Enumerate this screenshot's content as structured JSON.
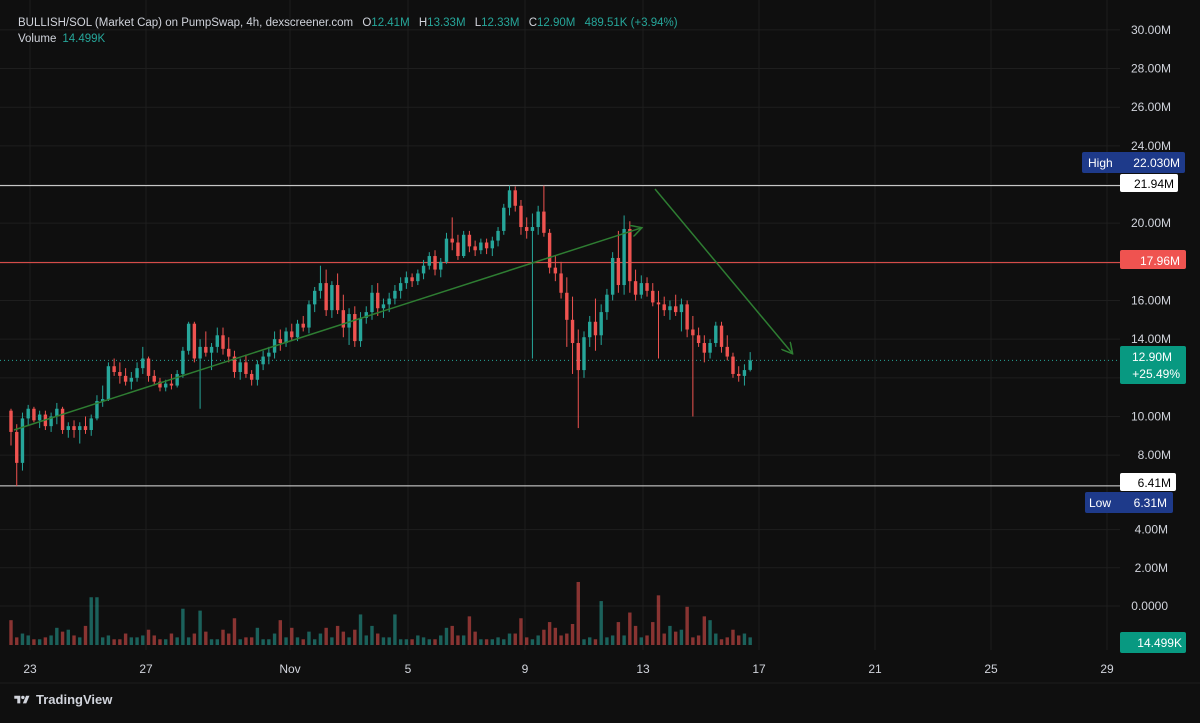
{
  "legend": {
    "symbol": "BULLISH/SOL (Market Cap) on PumpSwap, 4h, dexscreener.com",
    "open_label": "O",
    "open": "12.41M",
    "high_label": "H",
    "high": "13.33M",
    "low_label": "L",
    "low": "12.33M",
    "close_label": "C",
    "close": "12.90M",
    "change": "489.51K (+3.94%)",
    "volume_label": "Volume",
    "volume": "14.499K"
  },
  "brand": "TradingView",
  "colors": {
    "up": "#26a69a",
    "down": "#ef5350",
    "bg": "#0f0f0f",
    "grid": "#1e1e1e",
    "arrow": "#2e7d32",
    "highlow_badge": "#1e3a8a"
  },
  "price_axis": {
    "ticks": [
      "30.00M",
      "28.00M",
      "26.00M",
      "24.00M",
      "22.00M",
      "20.00M",
      "18.00M",
      "16.00M",
      "14.00M",
      "12.00M",
      "10.00M",
      "8.00M"
    ]
  },
  "volume_axis": {
    "ticks": [
      "4.00M",
      "2.00M",
      "0.0000"
    ]
  },
  "time_axis": {
    "ticks": [
      "23",
      "27",
      "Nov",
      "5",
      "9",
      "13",
      "17",
      "21",
      "25",
      "29"
    ]
  },
  "badges": {
    "high_label": "High",
    "high_value": "22.030M",
    "white_top": "21.94M",
    "red_line": "17.96M",
    "last_price": "12.90M",
    "last_change": "+25.49%",
    "white_bottom": "6.41M",
    "low_label": "Low",
    "low_value": "6.31M",
    "volume_last": "14.499K"
  },
  "chart_data": {
    "type": "candlestick",
    "interval": "4h",
    "y_axis_unit": "M",
    "ylim": [
      6.0,
      30.5
    ],
    "horizontal_lines": [
      21.94,
      17.96,
      6.41
    ],
    "candles": [
      [
        10.3,
        10.4,
        8.5,
        9.2
      ],
      [
        9.2,
        9.6,
        6.4,
        7.6
      ],
      [
        7.6,
        10.2,
        7.2,
        9.9
      ],
      [
        9.9,
        10.6,
        9.5,
        10.4
      ],
      [
        10.4,
        10.5,
        9.7,
        9.8
      ],
      [
        9.8,
        10.3,
        9.4,
        10.1
      ],
      [
        10.1,
        10.3,
        9.3,
        9.5
      ],
      [
        9.5,
        10.2,
        9.2,
        10.0
      ],
      [
        10.0,
        10.7,
        9.6,
        10.4
      ],
      [
        10.4,
        10.5,
        9.1,
        9.3
      ],
      [
        9.3,
        9.7,
        8.9,
        9.5
      ],
      [
        9.5,
        9.8,
        8.9,
        9.3
      ],
      [
        9.3,
        9.7,
        8.6,
        9.5
      ],
      [
        9.5,
        10.0,
        9.1,
        9.3
      ],
      [
        9.3,
        10.1,
        9.0,
        9.9
      ],
      [
        9.9,
        11.1,
        9.8,
        10.8
      ],
      [
        10.8,
        11.6,
        10.5,
        10.9
      ],
      [
        10.9,
        12.8,
        10.8,
        12.6
      ],
      [
        12.6,
        13.0,
        12.1,
        12.3
      ],
      [
        12.3,
        12.8,
        11.7,
        12.1
      ],
      [
        12.1,
        12.5,
        11.6,
        11.8
      ],
      [
        11.8,
        12.3,
        11.4,
        12.0
      ],
      [
        12.0,
        12.8,
        11.8,
        12.5
      ],
      [
        12.5,
        13.6,
        12.2,
        13.0
      ],
      [
        13.0,
        13.1,
        11.8,
        12.1
      ],
      [
        12.1,
        12.4,
        11.6,
        11.8
      ],
      [
        11.8,
        12.0,
        11.3,
        11.5
      ],
      [
        11.5,
        11.9,
        11.3,
        11.7
      ],
      [
        11.7,
        12.2,
        11.4,
        11.6
      ],
      [
        11.6,
        12.4,
        11.5,
        12.2
      ],
      [
        12.2,
        13.6,
        12.0,
        13.4
      ],
      [
        13.4,
        14.9,
        13.2,
        14.8
      ],
      [
        14.8,
        14.9,
        12.8,
        13.0
      ],
      [
        13.0,
        14.0,
        10.4,
        13.6
      ],
      [
        13.6,
        14.4,
        13.1,
        13.3
      ],
      [
        13.3,
        13.8,
        12.4,
        13.6
      ],
      [
        13.6,
        14.6,
        13.3,
        14.2
      ],
      [
        14.2,
        14.6,
        13.2,
        13.5
      ],
      [
        13.5,
        14.1,
        12.8,
        13.1
      ],
      [
        13.1,
        13.4,
        12.0,
        12.3
      ],
      [
        12.3,
        13.0,
        11.9,
        12.8
      ],
      [
        12.8,
        13.2,
        12.0,
        12.2
      ],
      [
        12.2,
        12.4,
        11.6,
        11.9
      ],
      [
        11.9,
        12.9,
        11.6,
        12.7
      ],
      [
        12.7,
        13.4,
        12.4,
        13.1
      ],
      [
        13.1,
        13.6,
        12.7,
        13.3
      ],
      [
        13.3,
        14.4,
        13.0,
        14.0
      ],
      [
        14.0,
        14.5,
        13.4,
        13.8
      ],
      [
        13.8,
        14.6,
        13.6,
        14.4
      ],
      [
        14.4,
        14.8,
        13.9,
        14.1
      ],
      [
        14.1,
        15.0,
        13.9,
        14.8
      ],
      [
        14.8,
        15.2,
        14.4,
        14.6
      ],
      [
        14.6,
        16.0,
        14.3,
        15.8
      ],
      [
        15.8,
        16.7,
        15.4,
        16.5
      ],
      [
        16.5,
        17.8,
        16.1,
        16.9
      ],
      [
        16.9,
        17.6,
        15.2,
        15.5
      ],
      [
        15.5,
        17.0,
        15.1,
        16.8
      ],
      [
        16.8,
        17.4,
        15.3,
        15.5
      ],
      [
        15.5,
        16.3,
        14.1,
        14.6
      ],
      [
        14.6,
        15.6,
        13.7,
        15.3
      ],
      [
        15.3,
        15.7,
        13.6,
        13.9
      ],
      [
        13.9,
        15.4,
        13.6,
        15.1
      ],
      [
        15.1,
        15.7,
        14.8,
        15.4
      ],
      [
        15.4,
        16.8,
        15.0,
        16.4
      ],
      [
        16.4,
        16.9,
        15.2,
        15.6
      ],
      [
        15.6,
        16.1,
        15.1,
        15.8
      ],
      [
        15.8,
        16.4,
        15.4,
        16.1
      ],
      [
        16.1,
        16.8,
        15.8,
        16.5
      ],
      [
        16.5,
        17.2,
        16.1,
        16.9
      ],
      [
        16.9,
        17.5,
        16.6,
        17.2
      ],
      [
        17.2,
        17.4,
        16.7,
        17.0
      ],
      [
        17.0,
        17.6,
        16.8,
        17.4
      ],
      [
        17.4,
        18.1,
        17.1,
        17.8
      ],
      [
        17.8,
        18.5,
        17.6,
        18.3
      ],
      [
        18.3,
        18.6,
        17.3,
        17.6
      ],
      [
        17.6,
        18.2,
        17.2,
        18.0
      ],
      [
        18.0,
        19.5,
        17.9,
        19.2
      ],
      [
        19.2,
        20.3,
        18.6,
        19.0
      ],
      [
        19.0,
        19.4,
        18.1,
        18.3
      ],
      [
        18.3,
        19.6,
        18.2,
        19.4
      ],
      [
        19.4,
        19.6,
        18.5,
        18.8
      ],
      [
        18.8,
        19.1,
        18.3,
        18.6
      ],
      [
        18.6,
        19.2,
        18.4,
        19.0
      ],
      [
        19.0,
        19.2,
        18.4,
        18.7
      ],
      [
        18.7,
        19.3,
        18.3,
        19.1
      ],
      [
        19.1,
        19.8,
        18.8,
        19.6
      ],
      [
        19.6,
        21.0,
        19.4,
        20.8
      ],
      [
        20.8,
        21.94,
        20.4,
        21.7
      ],
      [
        21.7,
        21.9,
        20.6,
        20.9
      ],
      [
        20.9,
        21.2,
        19.4,
        19.8
      ],
      [
        19.8,
        20.3,
        19.2,
        19.6
      ],
      [
        19.6,
        20.5,
        13.0,
        19.8
      ],
      [
        19.8,
        20.9,
        19.4,
        20.6
      ],
      [
        20.6,
        21.94,
        19.3,
        19.5
      ],
      [
        19.5,
        19.7,
        17.4,
        17.7
      ],
      [
        17.7,
        18.3,
        17.0,
        17.4
      ],
      [
        17.4,
        18.0,
        16.1,
        16.4
      ],
      [
        16.4,
        17.2,
        13.6,
        15.0
      ],
      [
        15.0,
        16.2,
        12.2,
        13.8
      ],
      [
        13.8,
        14.5,
        9.4,
        12.4
      ],
      [
        12.4,
        14.4,
        12.0,
        14.1
      ],
      [
        14.1,
        15.2,
        13.6,
        14.9
      ],
      [
        14.9,
        16.1,
        13.4,
        14.2
      ],
      [
        14.2,
        15.8,
        13.7,
        15.4
      ],
      [
        15.4,
        16.6,
        15.0,
        16.3
      ],
      [
        16.3,
        18.5,
        16.0,
        18.2
      ],
      [
        18.2,
        19.6,
        16.4,
        16.8
      ],
      [
        16.8,
        20.4,
        16.3,
        19.7
      ],
      [
        19.7,
        20.1,
        16.4,
        17.0
      ],
      [
        17.0,
        17.6,
        16.0,
        16.3
      ],
      [
        16.3,
        17.3,
        16.1,
        16.9
      ],
      [
        16.9,
        17.2,
        16.2,
        16.5
      ],
      [
        16.5,
        16.9,
        15.7,
        15.9
      ],
      [
        15.9,
        16.5,
        13.0,
        15.8
      ],
      [
        15.8,
        16.2,
        15.2,
        15.5
      ],
      [
        15.5,
        16.0,
        15.0,
        15.7
      ],
      [
        15.7,
        16.3,
        15.2,
        15.4
      ],
      [
        15.4,
        16.1,
        14.4,
        15.8
      ],
      [
        15.8,
        16.0,
        14.1,
        14.5
      ],
      [
        14.5,
        15.2,
        10.0,
        14.2
      ],
      [
        14.2,
        14.6,
        13.6,
        13.8
      ],
      [
        13.8,
        14.2,
        12.8,
        13.3
      ],
      [
        13.3,
        14.0,
        13.0,
        13.8
      ],
      [
        13.8,
        14.9,
        13.6,
        14.7
      ],
      [
        14.7,
        14.9,
        13.3,
        13.6
      ],
      [
        13.6,
        14.2,
        12.9,
        13.1
      ],
      [
        13.1,
        13.3,
        12.0,
        12.2
      ],
      [
        12.2,
        12.6,
        11.8,
        12.1
      ],
      [
        12.1,
        12.7,
        11.6,
        12.4
      ],
      [
        12.41,
        13.33,
        12.33,
        12.9
      ]
    ],
    "volume": [
      1.3,
      0.4,
      0.6,
      0.5,
      0.3,
      0.3,
      0.4,
      0.5,
      0.9,
      0.7,
      0.8,
      0.5,
      0.4,
      1.0,
      2.5,
      0.9,
      0.4,
      0.5,
      0.3,
      0.3,
      0.6,
      0.4,
      0.4,
      0.5,
      0.8,
      0.5,
      0.3,
      0.3,
      0.6,
      0.4,
      1.0,
      0.4,
      0.6,
      1.8,
      0.7,
      0.3,
      0.3,
      0.8,
      0.6,
      1.4,
      0.3,
      0.4,
      0.4,
      0.9,
      0.3,
      0.3,
      0.6,
      1.3,
      0.4,
      0.9,
      0.4,
      0.3,
      0.7,
      0.3,
      0.6,
      0.9,
      0.4,
      1.0,
      0.7,
      0.4,
      0.8,
      0.5,
      0.5,
      1.0,
      0.6,
      0.4,
      0.4,
      1.6,
      0.3,
      0.3,
      0.3,
      0.5,
      0.4,
      0.3,
      0.3,
      0.5,
      0.4,
      1.0,
      0.5,
      0.5,
      0.8,
      0.7,
      0.3,
      0.3,
      0.3,
      0.4,
      0.3,
      0.6,
      0.6,
      1.4,
      0.4,
      0.3,
      0.5,
      0.8,
      1.2,
      0.9,
      0.5,
      0.6,
      1.1,
      0.4,
      0.3,
      0.4,
      0.3,
      1.0,
      0.4,
      0.5,
      1.2,
      0.5,
      0.6,
      1.0,
      0.4,
      0.5,
      1.2,
      0.6,
      0.6,
      1.0,
      0.7,
      0.8,
      0.9,
      0.4,
      0.5,
      1.5,
      0.4,
      0.6,
      0.3,
      0.4,
      0.8,
      0.5,
      0.6,
      0.4,
      0.9,
      0.4,
      0.3
    ],
    "volume_peaks": {
      "99": 3.3,
      "30": 1.9,
      "103": 2.3,
      "113": 2.6,
      "118": 2.0,
      "108": 1.7,
      "122": 1.3,
      "80": 1.5,
      "61": 1.6,
      "15": 2.5,
      "76": 0.9
    },
    "trendlines": [
      {
        "from": [
          "23",
          9.2
        ],
        "to": [
          "13",
          19.6
        ],
        "color": "green",
        "arrow": true
      },
      {
        "from": [
          "13",
          21.2
        ],
        "to": [
          "18",
          13.0
        ],
        "color": "green",
        "arrow": true
      }
    ]
  }
}
